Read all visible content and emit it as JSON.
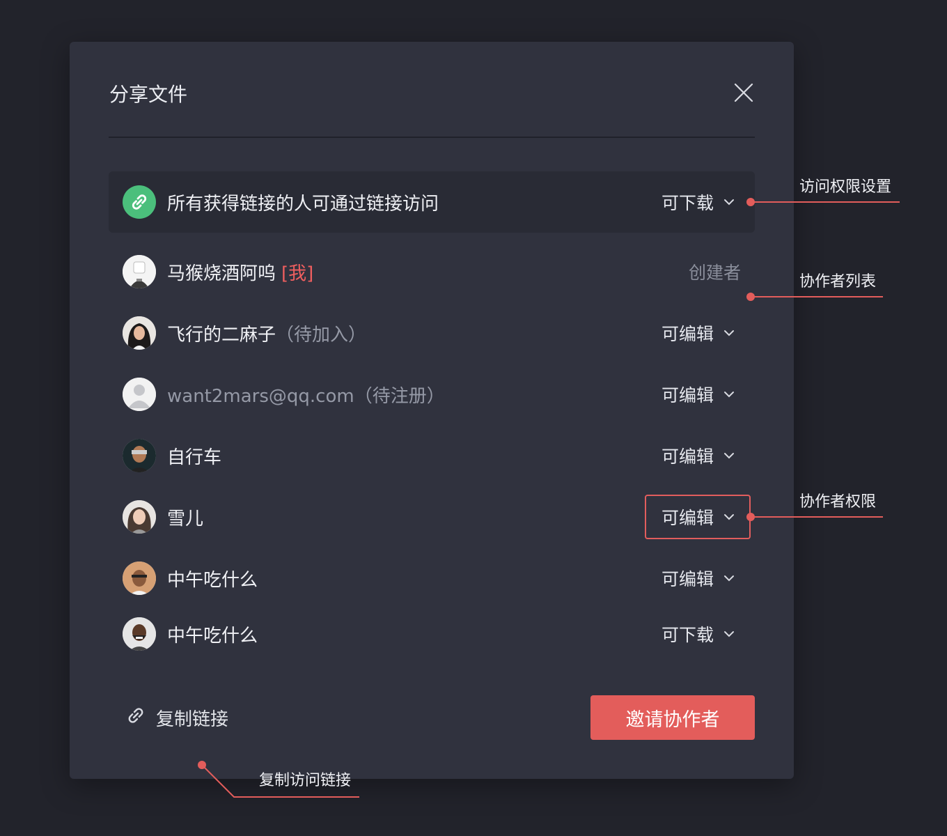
{
  "dialog": {
    "title": "分享文件",
    "link_access": {
      "text": "所有获得链接的人可通过链接访问",
      "permission": "可下载"
    },
    "members": [
      {
        "name": "马猴烧酒阿呜",
        "tag": "[我]",
        "role": "创建者"
      },
      {
        "name": "飞行的二麻子",
        "suffix": "（待加入）",
        "permission": "可编辑"
      },
      {
        "name": "want2mars@qq.com（待注册）",
        "permission": "可编辑"
      },
      {
        "name": "自行车",
        "permission": "可编辑"
      },
      {
        "name": "雪儿",
        "permission": "可编辑"
      },
      {
        "name": "中午吃什么",
        "permission": "可编辑"
      },
      {
        "name": "中午吃什么",
        "permission": "可下载"
      }
    ],
    "copy_link_label": "复制链接",
    "invite_button": "邀请协作者"
  },
  "annotations": {
    "access_settings": "访问权限设置",
    "collaborator_list": "协作者列表",
    "collaborator_permission": "协作者权限",
    "copy_access_link": "复制访问链接"
  },
  "colors": {
    "accent": "#e35d5b",
    "link_green": "#4bbf7c",
    "background": "#22232b",
    "panel": "#30323e"
  },
  "icons": [
    "close-icon",
    "link-icon",
    "chevron-down-icon"
  ]
}
